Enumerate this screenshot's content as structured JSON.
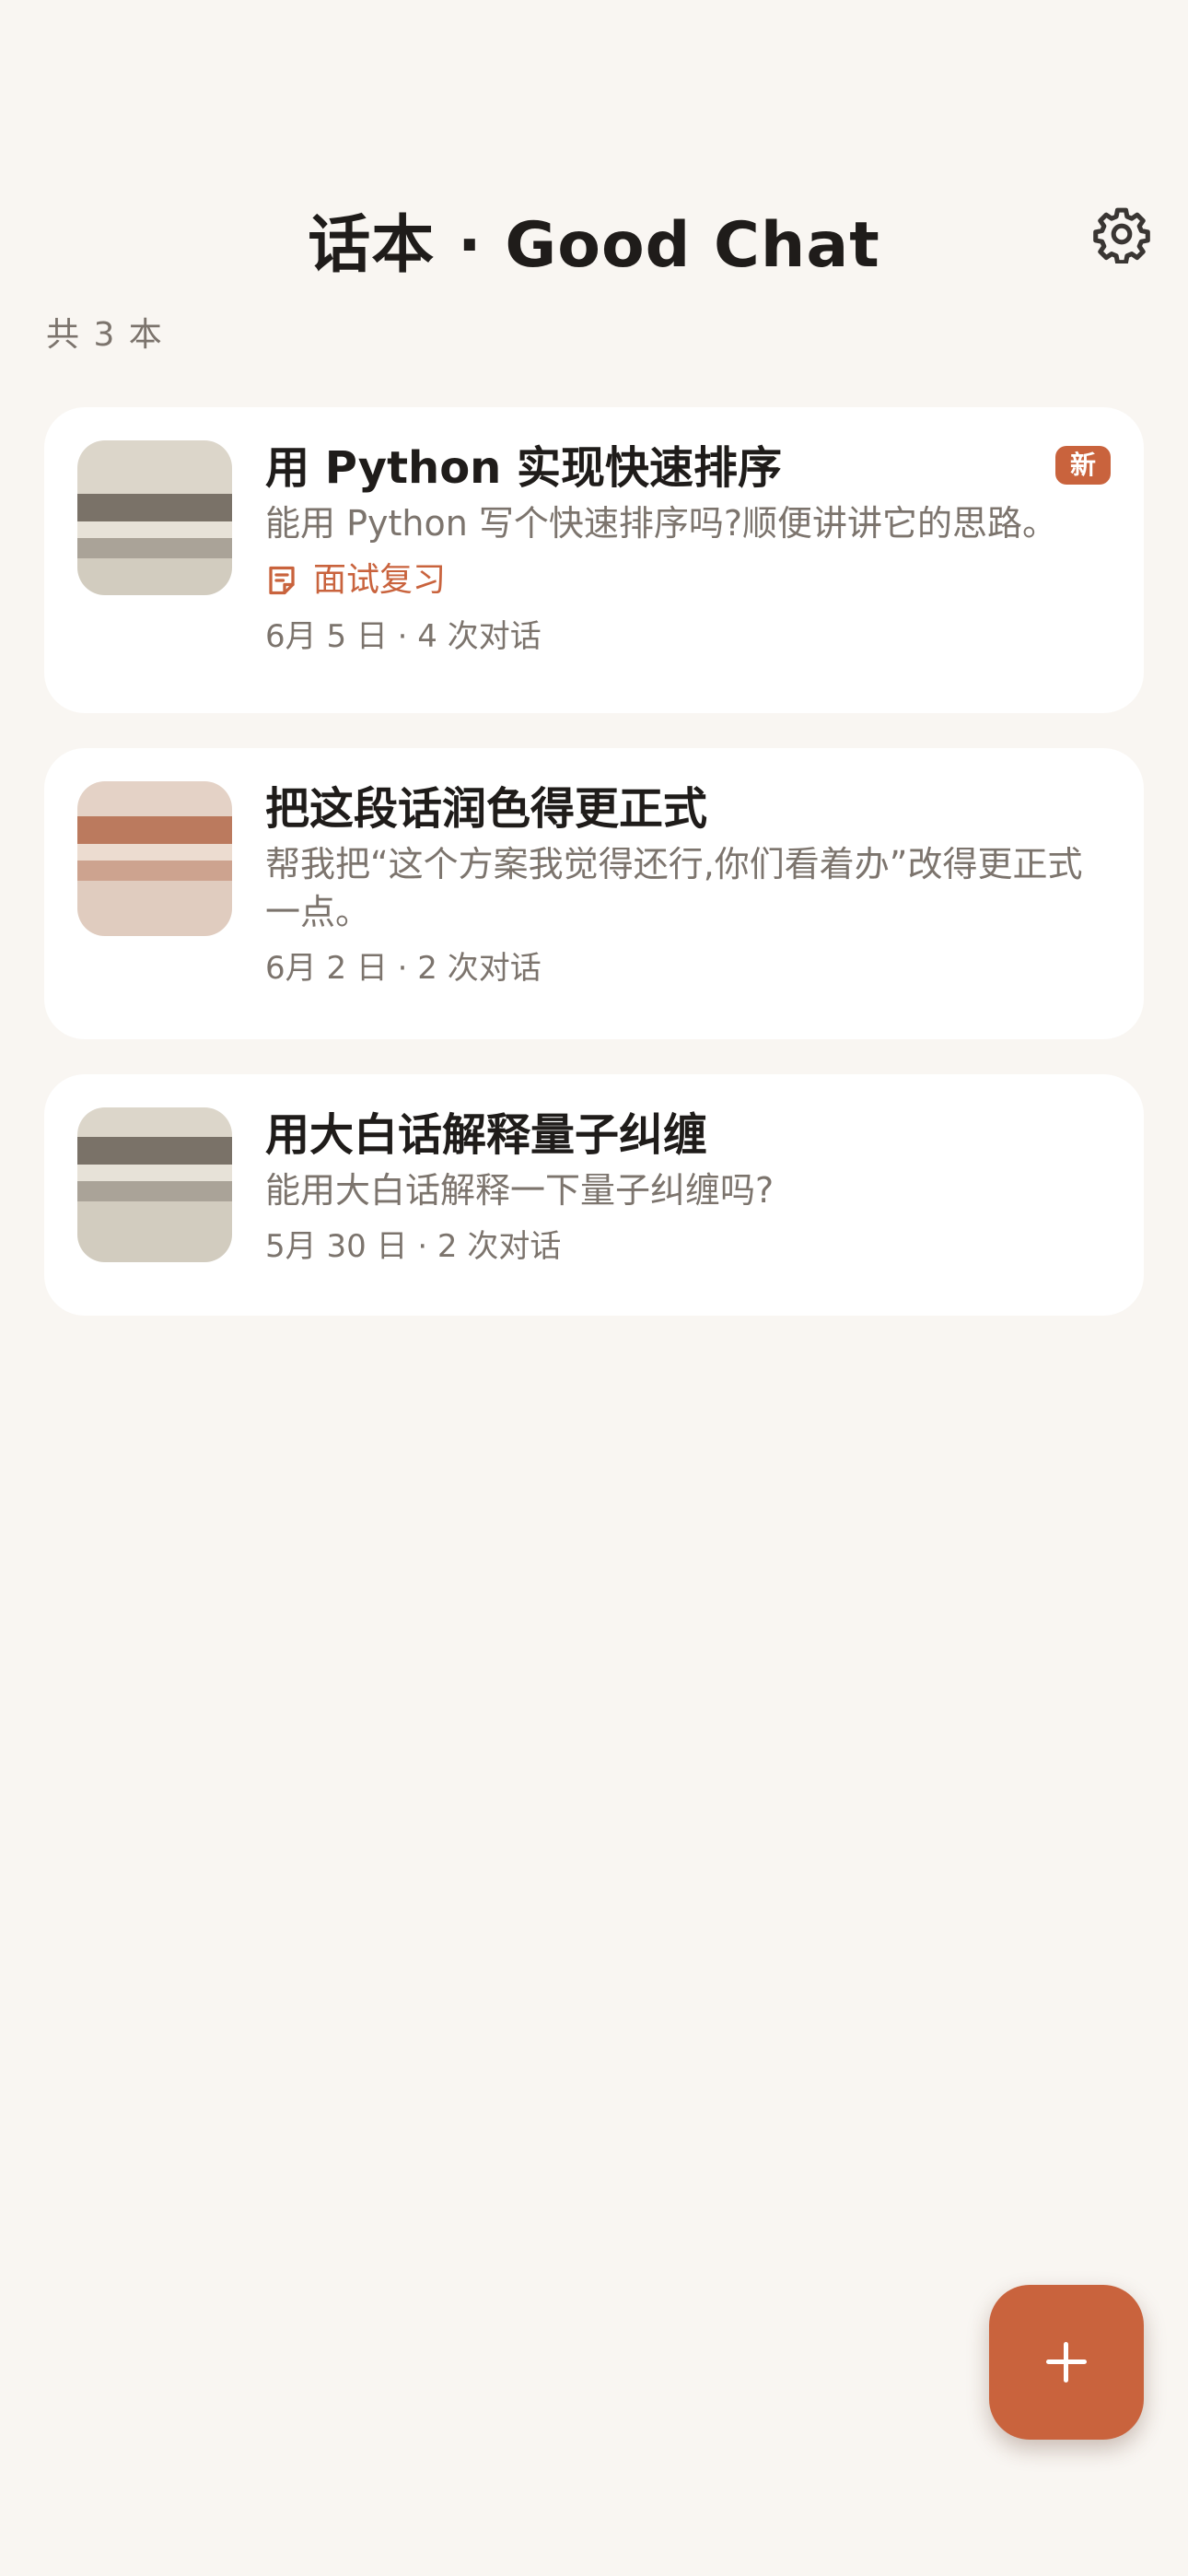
{
  "header": {
    "title": "话本 · Good Chat",
    "settings_icon": "gear-icon",
    "count_text": "共 3 本"
  },
  "conversations": [
    {
      "title": "用 Python 实现快速排序",
      "preview": "能用 Python 写个快速排序吗?顺便讲讲它的思路。",
      "tag": "面试复习",
      "tag_icon": "note-icon",
      "meta": "6月 5 日 · 4 次对话",
      "badge": "新",
      "thumb_colors": [
        "#dcd6ca",
        "#7a7268",
        "#e7e2d8",
        "#aaa398",
        "#d2ccbf"
      ]
    },
    {
      "title": "把这段话润色得更正式",
      "preview": "帮我把“这个方案我觉得还行,你们看着办”改得更正式一点。",
      "meta": "6月 2 日 · 2 次对话",
      "thumb_colors": [
        "#e4d2c6",
        "#bb7a5e",
        "#ecdcd0",
        "#cda38f",
        "#e0ccbf"
      ]
    },
    {
      "title": "用大白话解释量子纠缠",
      "preview": "能用大白话解释一下量子纠缠吗?",
      "meta": "5月 30 日 · 2 次对话",
      "thumb_colors": [
        "#dcd6ca",
        "#7a7268",
        "#e7e2d8",
        "#aaa398",
        "#d2ccbf"
      ]
    }
  ],
  "fab": {
    "icon": "plus-icon"
  },
  "colors": {
    "background": "#f9f6f2",
    "accent": "#c9633d",
    "card": "#ffffff",
    "text_primary": "#1f1c1a",
    "text_secondary": "#7c746d"
  }
}
